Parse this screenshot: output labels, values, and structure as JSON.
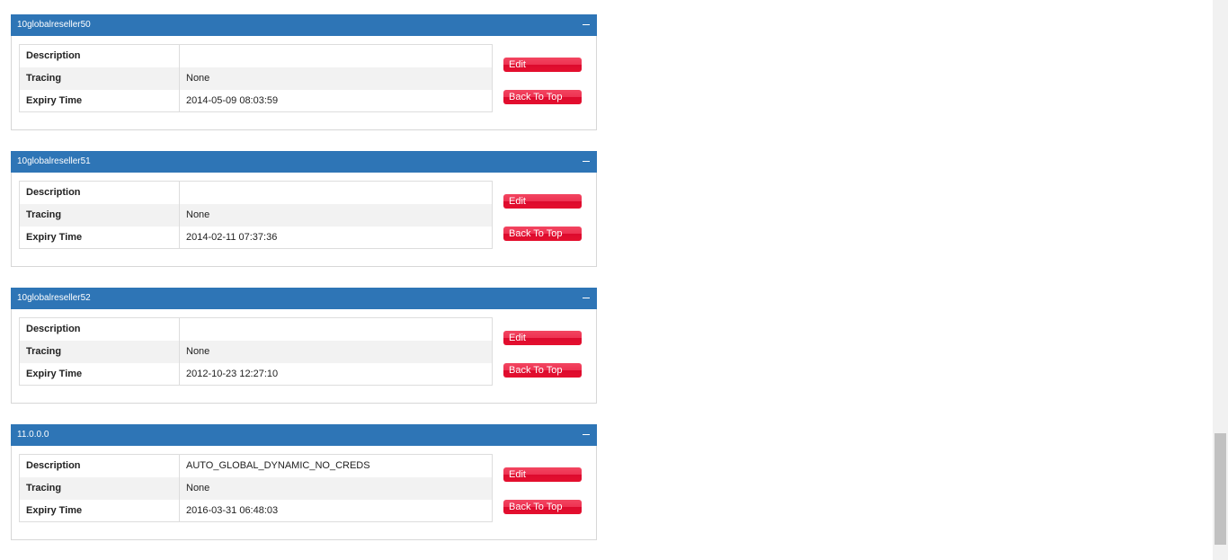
{
  "labels": {
    "description": "Description",
    "tracing": "Tracing",
    "expiry_time": "Expiry Time",
    "edit_button": "Edit",
    "back_to_top_button": "Back To Top"
  },
  "panels": [
    {
      "title": "10globalreseller50",
      "description": "",
      "tracing": "None",
      "expiry_time": "2014-05-09 08:03:59"
    },
    {
      "title": "10globalreseller51",
      "description": "",
      "tracing": "None",
      "expiry_time": "2014-02-11 07:37:36"
    },
    {
      "title": "10globalreseller52",
      "description": "",
      "tracing": "None",
      "expiry_time": "2012-10-23 12:27:10"
    },
    {
      "title": "11.0.0.0",
      "description": "AUTO_GLOBAL_DYNAMIC_NO_CREDS",
      "tracing": "None",
      "expiry_time": "2016-03-31 06:48:03"
    }
  ],
  "colors": {
    "header_bg": "#2e75b6",
    "button_red": "#e8183a"
  },
  "scrollbar": {
    "scroll_position": 0.95
  }
}
